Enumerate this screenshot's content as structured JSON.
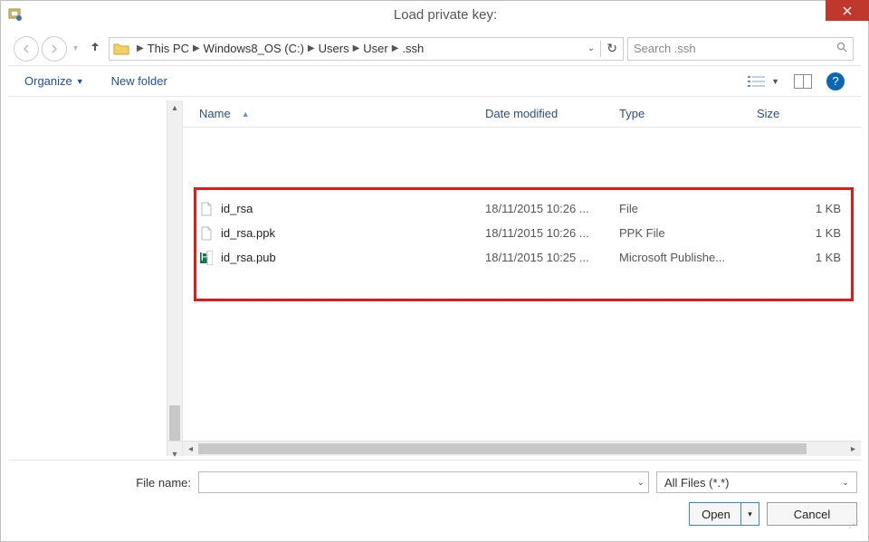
{
  "title": "Load private key:",
  "close_label": "✕",
  "breadcrumbs": [
    "This PC",
    "Windows8_OS (C:)",
    "Users",
    "User",
    ".ssh"
  ],
  "search": {
    "placeholder": "Search .ssh"
  },
  "toolbar": {
    "organize": "Organize",
    "newfolder": "New folder"
  },
  "columns": {
    "name": "Name",
    "date": "Date modified",
    "type": "Type",
    "size": "Size"
  },
  "files": [
    {
      "name": "id_rsa",
      "date": "18/11/2015 10:26 ...",
      "type": "File",
      "size": "1 KB",
      "icon": "file"
    },
    {
      "name": "id_rsa.ppk",
      "date": "18/11/2015 10:26 ...",
      "type": "PPK File",
      "size": "1 KB",
      "icon": "file"
    },
    {
      "name": "id_rsa.pub",
      "date": "18/11/2015 10:25 ...",
      "type": "Microsoft Publishe...",
      "size": "1 KB",
      "icon": "pub"
    }
  ],
  "filename_label": "File name:",
  "filter": {
    "selected": "All Files (*.*)"
  },
  "buttons": {
    "open": "Open",
    "cancel": "Cancel"
  }
}
